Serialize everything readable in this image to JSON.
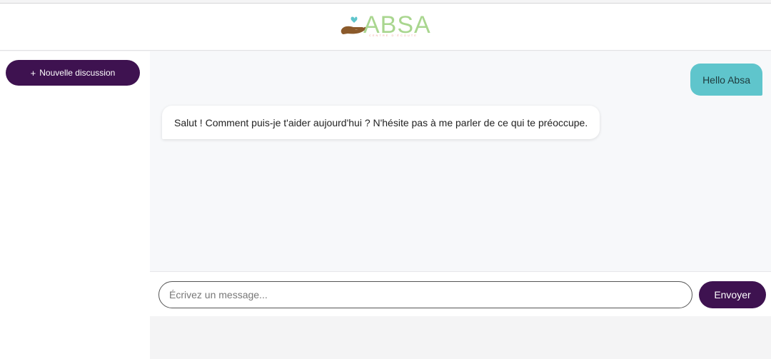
{
  "header": {
    "logo": {
      "text": "ABSA",
      "subtext": "CENTRE D'ÉCOUTE",
      "icon": "hand-heart-icon",
      "colors": {
        "text": "#a9d68f",
        "hand": "#8b5a2b",
        "heart": "#5fc5cc"
      }
    }
  },
  "sidebar": {
    "new_chat": {
      "icon": "+",
      "label": "Nouvelle discussion"
    }
  },
  "chat": {
    "messages": [
      {
        "role": "user",
        "text": "Hello Absa"
      },
      {
        "role": "assistant",
        "text": "Salut ! Comment puis-je t'aider aujourd'hui ? N'hésite pas à me parler de ce qui te préoccupe."
      }
    ]
  },
  "composer": {
    "placeholder": "Écrivez un message...",
    "value": "",
    "send_label": "Envoyer"
  },
  "colors": {
    "primary": "#3e1250",
    "user_bubble": "#5fc5cc",
    "bot_bubble": "#ffffff"
  }
}
